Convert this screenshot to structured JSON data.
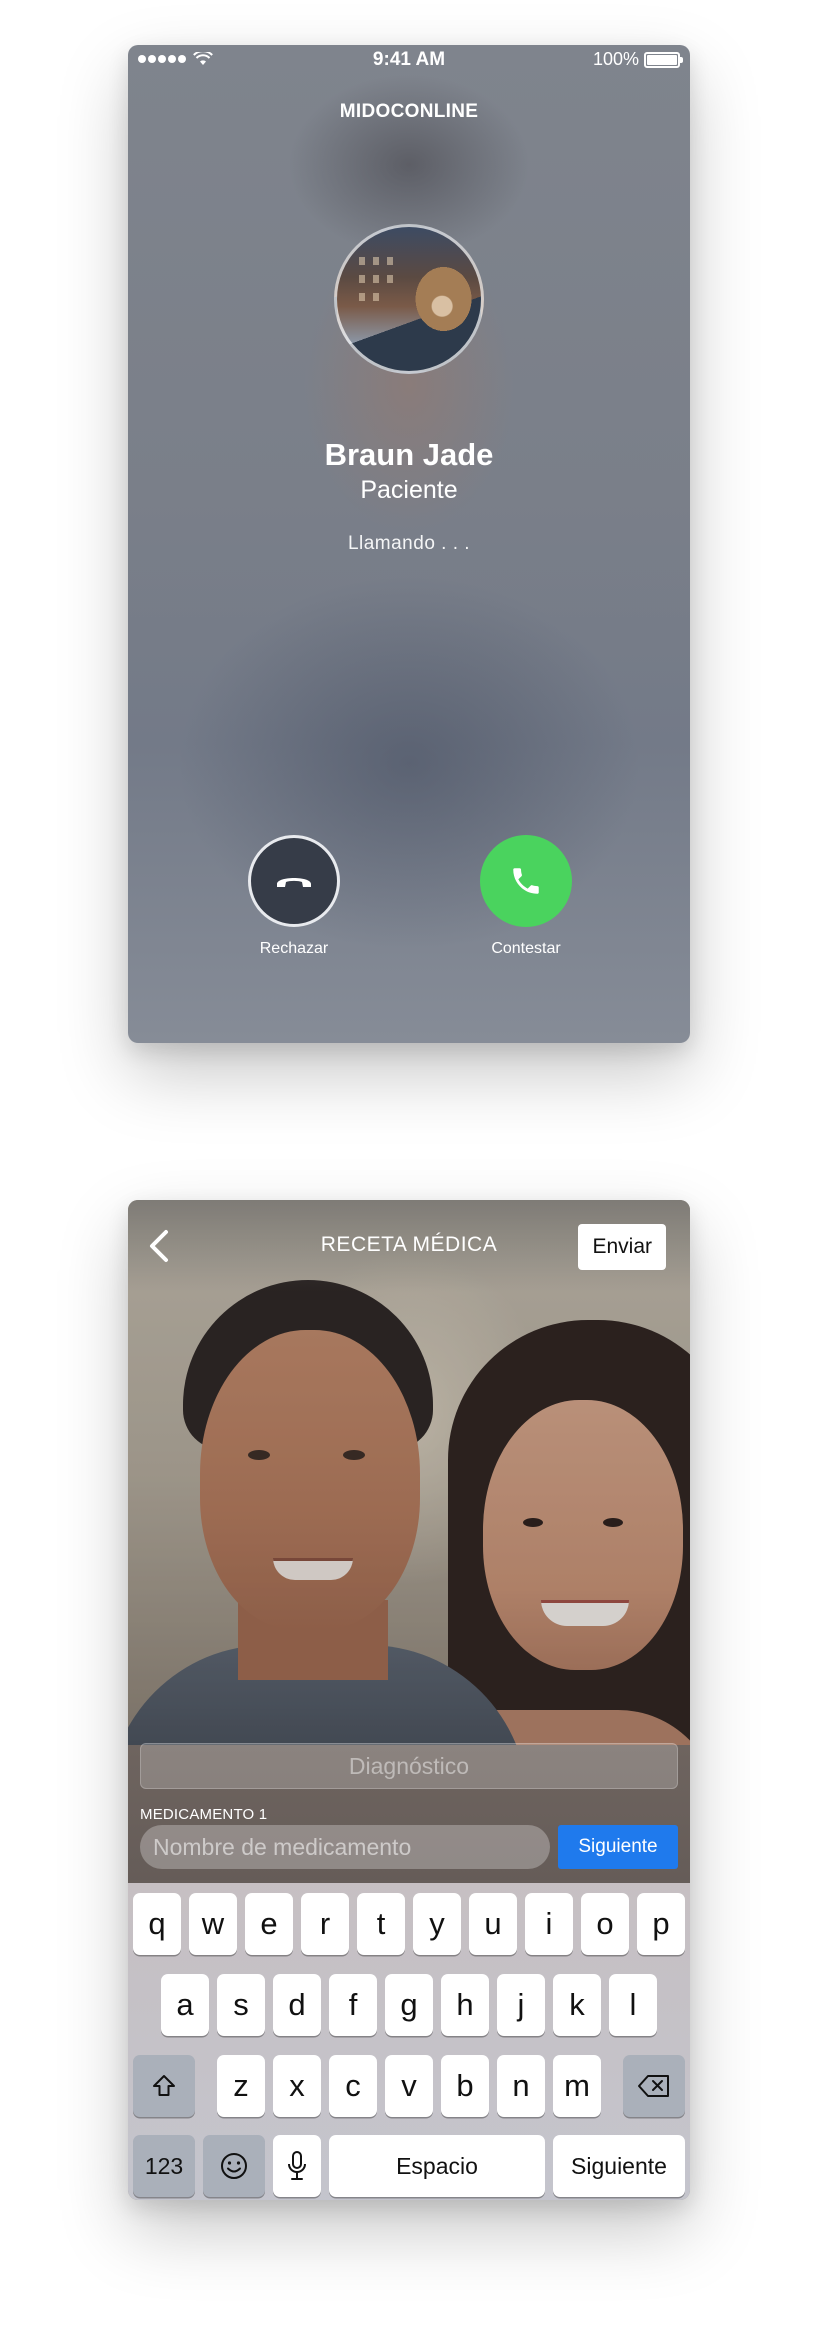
{
  "call_screen": {
    "status_bar": {
      "time": "9:41 AM",
      "battery": "100%"
    },
    "brand": "MIDOCONLINE",
    "caller_name": "Braun Jade",
    "caller_role": "Paciente",
    "call_status": "Llamando . . .",
    "decline_label": "Rechazar",
    "answer_label": "Contestar",
    "colors": {
      "decline": "#363c48",
      "answer": "#4ad35e"
    }
  },
  "prescription_screen": {
    "nav": {
      "title": "RECETA MÉDICA",
      "send_label": "Enviar"
    },
    "diagnosis": {
      "placeholder": "Diagnóstico"
    },
    "medication": {
      "label": "MEDICAMENTO 1",
      "placeholder": "Nombre de medicamento",
      "next_label": "Siguiente"
    },
    "colors": {
      "accent": "#1f7aed"
    },
    "keyboard": {
      "row1": [
        "q",
        "w",
        "e",
        "r",
        "t",
        "y",
        "u",
        "i",
        "o",
        "p"
      ],
      "row2": [
        "a",
        "s",
        "d",
        "f",
        "g",
        "h",
        "j",
        "k",
        "l"
      ],
      "row3": [
        "z",
        "x",
        "c",
        "v",
        "b",
        "n",
        "m"
      ],
      "numbers_key": "123",
      "space_key": "Espacio",
      "return_key": "Siguiente"
    }
  }
}
